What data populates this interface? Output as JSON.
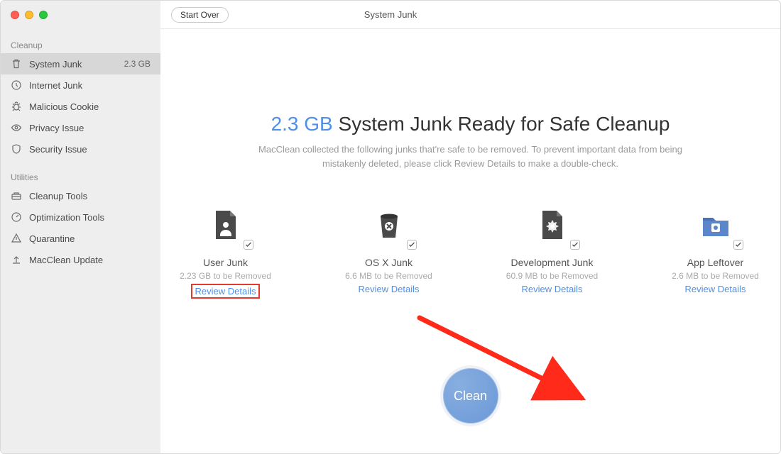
{
  "titlebar": {
    "title": "System Junk",
    "start_over": "Start Over"
  },
  "sidebar": {
    "sections": [
      {
        "label": "Cleanup",
        "items": [
          {
            "icon": "trash-icon",
            "label": "System Junk",
            "badge": "2.3 GB",
            "active": true
          },
          {
            "icon": "clock-icon",
            "label": "Internet Junk"
          },
          {
            "icon": "bug-icon",
            "label": "Malicious Cookie"
          },
          {
            "icon": "eye-icon",
            "label": "Privacy Issue"
          },
          {
            "icon": "shield-icon",
            "label": "Security Issue"
          }
        ]
      },
      {
        "label": "Utilities",
        "items": [
          {
            "icon": "toolbox-icon",
            "label": "Cleanup Tools"
          },
          {
            "icon": "gauge-icon",
            "label": "Optimization Tools"
          },
          {
            "icon": "warning-icon",
            "label": "Quarantine"
          },
          {
            "icon": "upload-icon",
            "label": "MacClean Update"
          }
        ]
      }
    ]
  },
  "hero": {
    "accent": "2.3 GB",
    "rest": " System Junk Ready for Safe Cleanup",
    "subtitle": "MacClean collected the following junks that're safe to be removed. To prevent important data from being mistakenly deleted, please click Review Details to make a double-check."
  },
  "cards": [
    {
      "name": "User Junk",
      "size": "2.23 GB to be Removed",
      "link": "Review Details",
      "highlighted": true,
      "icon": "user-file-icon"
    },
    {
      "name": "OS X Junk",
      "size": "6.6 MB to be Removed",
      "link": "Review Details",
      "icon": "trash-bin-icon"
    },
    {
      "name": "Development Junk",
      "size": "60.9 MB to be Removed",
      "link": "Review Details",
      "icon": "gear-file-icon"
    },
    {
      "name": "App Leftover",
      "size": "2.6 MB to be Removed",
      "link": "Review Details",
      "icon": "app-folder-icon"
    }
  ],
  "clean_button": "Clean",
  "colors": {
    "accent": "#4f8fe8",
    "arrow": "#ff2a1a"
  }
}
